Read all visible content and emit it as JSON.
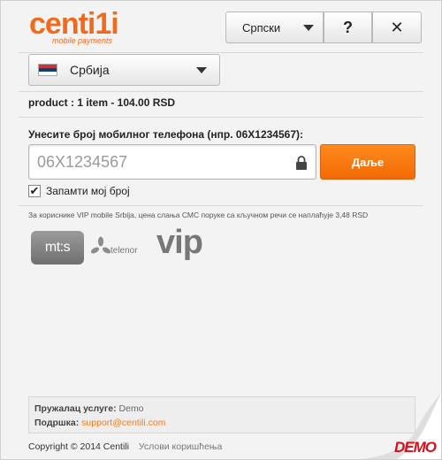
{
  "header": {
    "logo_text": "centi1i",
    "logo_subtitle": "mobile payments",
    "language_label": "Српски",
    "help_label": "?",
    "close_label": "✕"
  },
  "country": {
    "label": "Србија",
    "flag_colors": [
      "#c6363c",
      "#0c4076",
      "#ffffff"
    ]
  },
  "product": {
    "text": "product : 1 item - 104.00 RSD"
  },
  "phone": {
    "label": "Унесите број мобилног телефона (нпр. 06X1234567):",
    "placeholder": "06X1234567",
    "value": "",
    "next_label": "Даље"
  },
  "remember": {
    "label": "Запамти мој број",
    "checked": true
  },
  "note": {
    "text": "За кориснике VIP mobile Srbija, цена слања СМС поруке са кључном речи се наплаћује 3,48 RSD"
  },
  "operators": {
    "mts": "mt:s",
    "telenor": "telenor",
    "vip": "vip"
  },
  "provider": {
    "service_label": "Пружалац услуге:",
    "service_value": "Demo",
    "support_label": "Подршка:",
    "support_value": "support@centili.com"
  },
  "footer": {
    "copyright": "Copyright © 2014 Centili",
    "terms": "Услови коришћења"
  },
  "badge": {
    "demo": "DEMO"
  },
  "colors": {
    "accent": "#f26b1d",
    "button_orange": "#f47a10",
    "demo_red": "#d60f1a"
  }
}
